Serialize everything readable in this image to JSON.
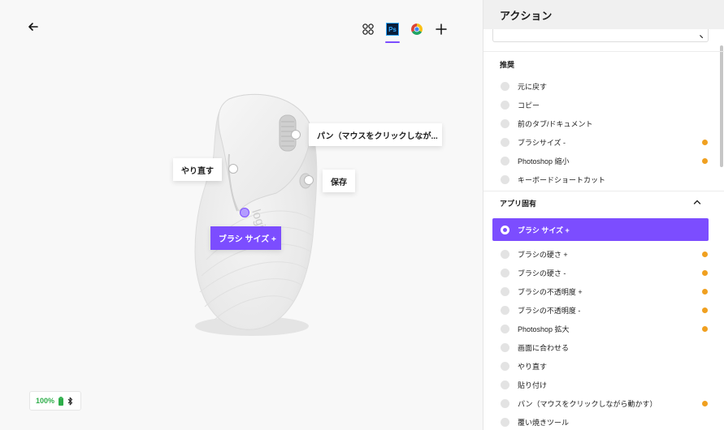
{
  "window": {
    "controls": [
      "close",
      "minimize",
      "zoom"
    ]
  },
  "toolbar": {
    "back_icon": "arrow-left-icon",
    "apps": [
      {
        "name": "all-apps",
        "icon": "apps-grid-icon",
        "active": false
      },
      {
        "name": "photoshop",
        "icon": "photoshop-icon",
        "label": "Ps",
        "active": true
      },
      {
        "name": "chrome",
        "icon": "chrome-icon",
        "active": false
      },
      {
        "name": "add-app",
        "icon": "plus-icon",
        "active": false
      }
    ]
  },
  "mouse": {
    "callouts": {
      "top": "パン（マウスをクリックしなが...",
      "redo": "やり直す",
      "save": "保存",
      "assigned": "ブラシ サイズ +"
    },
    "logo_text": "logi"
  },
  "battery": {
    "level": "100%",
    "level_value": 1.0,
    "connection_icon": "bluetooth-icon"
  },
  "panel": {
    "title": "アクション",
    "search": {
      "placeholder": ""
    },
    "recommended": {
      "title": "推奨",
      "items": [
        {
          "label": "元に戻す",
          "warn": false
        },
        {
          "label": "コピー",
          "warn": false
        },
        {
          "label": "前のタブ/ドキュメント",
          "warn": false
        },
        {
          "label": "ブラシサイズ -",
          "warn": true
        },
        {
          "label": "Photoshop 縮小",
          "warn": true
        },
        {
          "label": "キーボードショートカット",
          "warn": false
        }
      ]
    },
    "app_specific": {
      "title": "アプリ固有",
      "expanded": true,
      "selected": "ブラシ サイズ +",
      "items": [
        {
          "label": "ブラシの硬さ +",
          "warn": true
        },
        {
          "label": "ブラシの硬さ -",
          "warn": true
        },
        {
          "label": "ブラシの不透明度 +",
          "warn": true
        },
        {
          "label": "ブラシの不透明度 -",
          "warn": true
        },
        {
          "label": "Photoshop 拡大",
          "warn": true
        },
        {
          "label": "画面に合わせる",
          "warn": false
        },
        {
          "label": "やり直す",
          "warn": false
        },
        {
          "label": "貼り付け",
          "warn": false
        },
        {
          "label": "パン（マウスをクリックしながら動かす）",
          "warn": true
        },
        {
          "label": "覆い焼きツール",
          "warn": false
        }
      ]
    }
  },
  "colors": {
    "accent": "#7c4dff",
    "warning": "#f0a020",
    "battery": "#2eae4a"
  }
}
